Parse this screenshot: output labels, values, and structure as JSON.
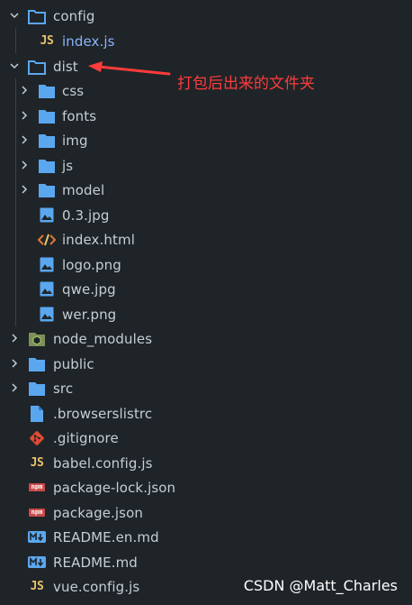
{
  "tree": {
    "config": {
      "label": "config"
    },
    "config_index": {
      "label": "index.js",
      "icon_text": "JS"
    },
    "dist": {
      "label": "dist"
    },
    "dist_children": {
      "css": {
        "label": "css"
      },
      "fonts": {
        "label": "fonts"
      },
      "img": {
        "label": "img"
      },
      "js": {
        "label": "js"
      },
      "model": {
        "label": "model"
      },
      "jpg03": {
        "label": "0.3.jpg"
      },
      "index_html": {
        "label": "index.html"
      },
      "logo": {
        "label": "logo.png"
      },
      "qwe": {
        "label": "qwe.jpg"
      },
      "wer": {
        "label": "wer.png"
      }
    },
    "node_modules": {
      "label": "node_modules"
    },
    "public": {
      "label": "public"
    },
    "src": {
      "label": "src"
    },
    "browserslistrc": {
      "label": ".browserslistrc"
    },
    "gitignore": {
      "label": ".gitignore"
    },
    "babel": {
      "label": "babel.config.js",
      "icon_text": "JS"
    },
    "package_lock": {
      "label": "package-lock.json",
      "icon_text": "npm"
    },
    "package": {
      "label": "package.json",
      "icon_text": "npm"
    },
    "readme_en": {
      "label": "README.en.md",
      "icon_text": "M↓"
    },
    "readme": {
      "label": "README.md",
      "icon_text": "M↓"
    },
    "vue_config": {
      "label": "vue.config.js",
      "icon_text": "JS"
    }
  },
  "annotation": {
    "text": "打包后出来的文件夹"
  },
  "watermark": {
    "text": "CSDN @Matt_Charles"
  },
  "colors": {
    "background": "#1f2428",
    "folder": "#5aa7f0",
    "js": "#e8c36a",
    "annotation": "#ff3b3b",
    "active_label": "#8ab4ff"
  }
}
